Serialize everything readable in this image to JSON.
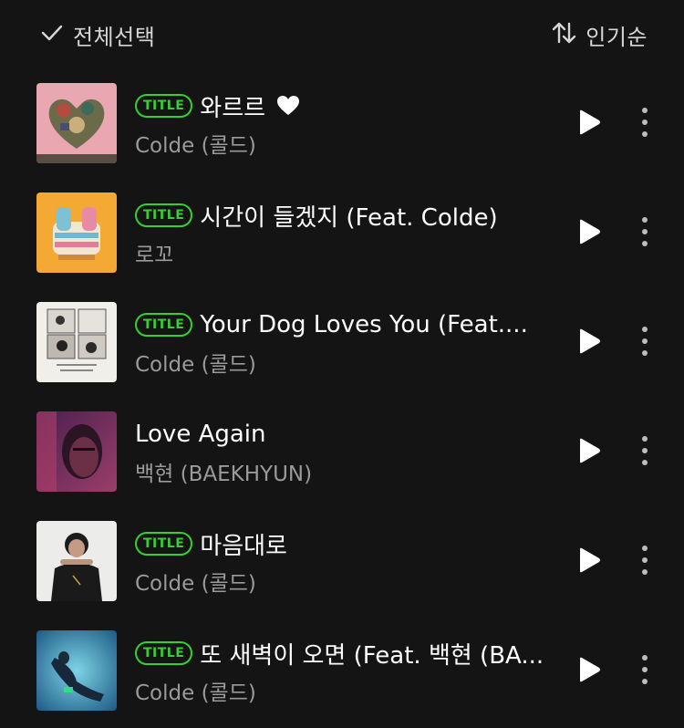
{
  "header": {
    "select_all_label": "전체선택",
    "sort_label": "인기순"
  },
  "badge_label": "TITLE",
  "colors": {
    "background": "#141414",
    "accent_green": "#35d12f",
    "artist_gray": "#9a9a9a"
  },
  "tracks": [
    {
      "title": "와르르",
      "artist": "Colde (콜드)",
      "is_title": true,
      "liked": true
    },
    {
      "title": "시간이 들겠지 (Feat. Colde)",
      "artist": "로꼬",
      "is_title": true,
      "liked": false
    },
    {
      "title": "Your Dog Loves You (Feat....",
      "artist": "Colde (콜드)",
      "is_title": true,
      "liked": false
    },
    {
      "title": "Love Again",
      "artist": "백현 (BAEKHYUN)",
      "is_title": false,
      "liked": false
    },
    {
      "title": "마음대로",
      "artist": "Colde (콜드)",
      "is_title": true,
      "liked": false
    },
    {
      "title": "또 새벽이 오면 (Feat. 백현 (BA...",
      "artist": "Colde (콜드)",
      "is_title": true,
      "liked": false
    }
  ],
  "icons": {
    "select": "check-icon",
    "sort": "sort-arrows-icon",
    "play": "play-icon",
    "more": "more-vertical-icon",
    "liked": "heart-icon"
  }
}
